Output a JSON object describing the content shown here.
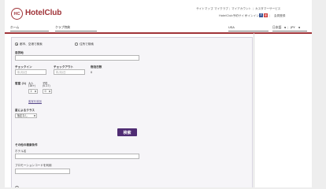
{
  "header": {
    "logo_mark": "HC",
    "logo_text": "HotelClub",
    "top_links": [
      "サイトマップ",
      "マイクラブ",
      "マイアカウント",
      "カスタマーサービス"
    ],
    "partner_link": "HotelClub予約サイト",
    "signin": "サインイン",
    "register": "会員登録",
    "nav": {
      "home": "ホーム",
      "club_benefits": "クラブ特典",
      "country": "USA",
      "language": "日本語",
      "currency": "JPY"
    }
  },
  "form": {
    "search_mode": {
      "city_airport": "都市、空港で検索",
      "address": "住所で検索",
      "selected": "city_airport"
    },
    "destination": {
      "label": "目的地",
      "value": ""
    },
    "checkin": {
      "label": "チェックイン",
      "placeholder": "年/月/日"
    },
    "checkout": {
      "label": "チェックアウト",
      "placeholder": "年/月/日"
    },
    "nights": {
      "label": "宿泊日数",
      "value": "0"
    },
    "rooms": {
      "label": "客室 (1)",
      "adults_label": "大人",
      "adults_sub": "(18+)",
      "adults_value": "2",
      "children_label": "子供",
      "children_sub": "(0-17)",
      "children_value": "0",
      "add_room": "客室を追加"
    },
    "star_class": {
      "label": "星によるクラス",
      "value": "指定なし"
    },
    "search_button": "検索",
    "other_conditions": "その他の検索条件",
    "hotel_name": {
      "label": "ホテル名",
      "value": ""
    },
    "promo_code": {
      "label": "プロモーションコードを利用",
      "value": ""
    }
  },
  "colors": {
    "brand": "#a03439",
    "button": "#4f2c73",
    "link": "#5a4b8c"
  }
}
